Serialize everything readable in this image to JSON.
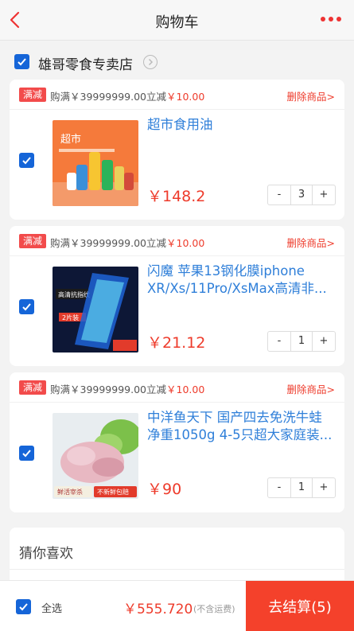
{
  "header": {
    "title": "购物车"
  },
  "store": {
    "name": "雄哥零食专卖店"
  },
  "promo": {
    "tag": "满减",
    "prefix": "购满￥39999999.00立减",
    "amount": "￥10.00",
    "delete": "删除商品>"
  },
  "items": [
    {
      "name": "超市食用油",
      "price": "￥148.2",
      "qty": "3"
    },
    {
      "name": "闪魔 苹果13钢化膜iphone XR/Xs/11Pro/XsMax高清非...",
      "price": "￥21.12",
      "qty": "1"
    },
    {
      "name": "中洋鱼天下 国产四去免洗牛蛙 净重1050g 4-5只超大家庭装...",
      "price": "￥90",
      "qty": "1"
    }
  ],
  "stepper": {
    "minus": "-",
    "plus": "+"
  },
  "guess": {
    "title": "猜你喜欢"
  },
  "footer": {
    "select_all": "全选",
    "total": "￥555.720",
    "note": "(不含运费)",
    "checkout": "去结算(5)"
  },
  "item_images": {
    "item1": {
      "badge": "超市"
    },
    "item2": {
      "badge1": "高清抗指纹",
      "badge2": "2片装"
    },
    "item3": {
      "badge1": "鲜活宰杀",
      "badge2": "不新鲜包赔"
    }
  },
  "colors": {
    "accent": "#1565d8",
    "price": "#ee3b2b",
    "checkout": "#f4412b",
    "link": "#2f7fd9"
  }
}
